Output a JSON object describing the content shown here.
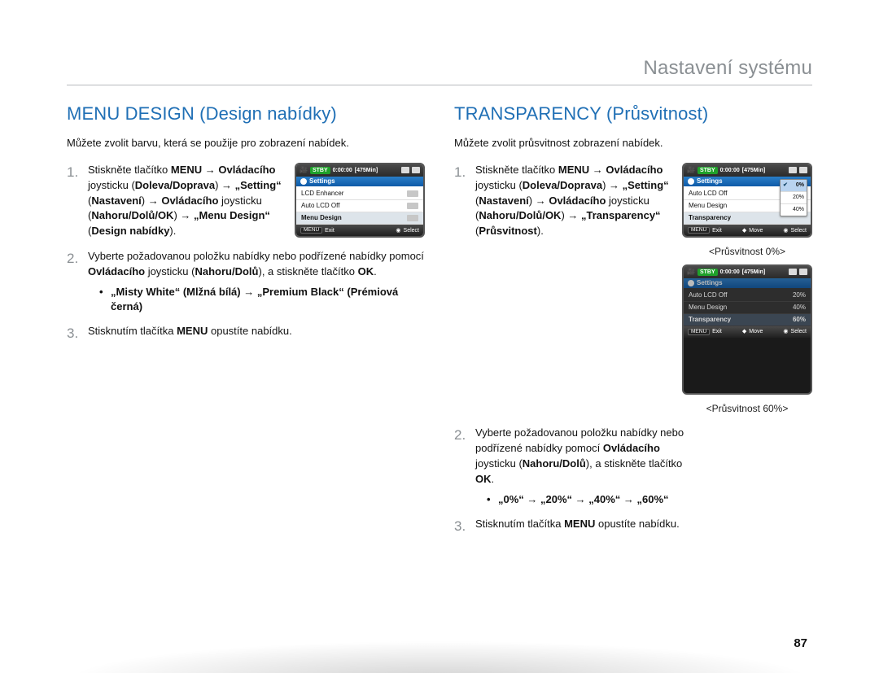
{
  "page_heading": "Nastavení systému",
  "page_number": "87",
  "left": {
    "title": "MENU DESIGN (Design nabídky)",
    "intro": "Můžete zvolit barvu, která se použije pro zobrazení nabídek.",
    "step1_html": "Stiskněte tlačítko <b>MENU</b> → <b>Ovládacího</b> joysticku (<b>Doleva/Doprava</b>) → <b>„Setting“</b> (<b>Nastavení</b>) → <b>Ovládacího</b> joysticku (<b>Nahoru/Dolů/OK</b>) → <b>„Menu Design“</b> (<b>Design nabídky</b>).",
    "step2_html": "Vyberte požadovanou položku nabídky nebo podřízené nabídky pomocí <b>Ovládacího</b> joysticku (<b>Nahoru/Dolů</b>), a stiskněte tlačítko <b>OK</b>.",
    "step2_bullet": "„Misty White“ (Mlžná bílá) → „Premium Black“ (Prémiová černá)",
    "step3_html": "Stisknutím tlačítka <b>MENU</b> opustíte nabídku.",
    "lcd": {
      "stby": "STBY",
      "timecode": "0:00:00",
      "remain": "[475Min]",
      "settings_title": "Settings",
      "rows": [
        "LCD Enhancer",
        "Auto LCD Off",
        "Menu Design"
      ],
      "bot_menu": "MENU",
      "bot_exit": "Exit",
      "bot_select": "Select"
    }
  },
  "right": {
    "title": "TRANSPARENCY (Průsvitnost)",
    "intro": "Můžete zvolit průsvitnost zobrazení nabídek.",
    "step1_html": "Stiskněte tlačítko <b>MENU</b> → <b>Ovládacího</b> joysticku (<b>Doleva/Doprava</b>) → <b>„Setting“</b> (<b>Nastavení</b>) → <b>Ovládacího</b> joysticku (<b>Nahoru/Dolů/OK</b>) → <b>„Transparency“</b> (<b>Průsvitnost</b>).",
    "step2_html": "Vyberte požadovanou položku nabídky nebo podřízené nabídky pomocí <b>Ovládacího</b> joysticku (<b>Nahoru/Dolů</b>), a stiskněte tlačítko <b>OK</b>.",
    "step2_bullet": "„0%“ → „20%“ → „40%“ → „60%“",
    "step3_html": "Stisknutím tlačítka <b>MENU</b> opustíte nabídku.",
    "lcd": {
      "stby": "STBY",
      "timecode": "0:00:00",
      "remain": "[475Min]",
      "settings_title": "Settings",
      "rows": [
        "Auto LCD Off",
        "Menu Design",
        "Transparency"
      ],
      "dropdown": [
        "0%",
        "20%",
        "40%"
      ],
      "bot_menu": "MENU",
      "bot_exit": "Exit",
      "bot_move": "Move",
      "bot_select": "Select"
    },
    "caption1": "<Průsvitnost 0%>",
    "caption2": "<Průsvitnost 60%>",
    "lcd2_rows": [
      "Auto LCD Off",
      "Menu Design",
      "Transparency"
    ],
    "lcd2_vals": [
      "20%",
      "40%",
      "60%"
    ]
  }
}
